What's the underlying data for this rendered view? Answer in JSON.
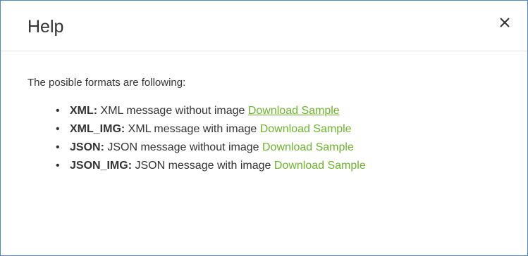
{
  "dialog": {
    "title": "Help",
    "close_icon": "close-icon",
    "intro": "The posible formats are following:",
    "formats": [
      {
        "name": "XML:",
        "description": " XML message without image ",
        "link_label": "Download Sample"
      },
      {
        "name": "XML_IMG:",
        "description": " XML message with image ",
        "link_label": "Download Sample"
      },
      {
        "name": "JSON:",
        "description": " JSON message without image ",
        "link_label": "Download Sample"
      },
      {
        "name": "JSON_IMG:",
        "description": " JSON message with image ",
        "link_label": "Download Sample"
      }
    ],
    "bullet": "•"
  },
  "colors": {
    "border": "#4f86c6",
    "link": "#6cb42c",
    "text": "#333333"
  }
}
